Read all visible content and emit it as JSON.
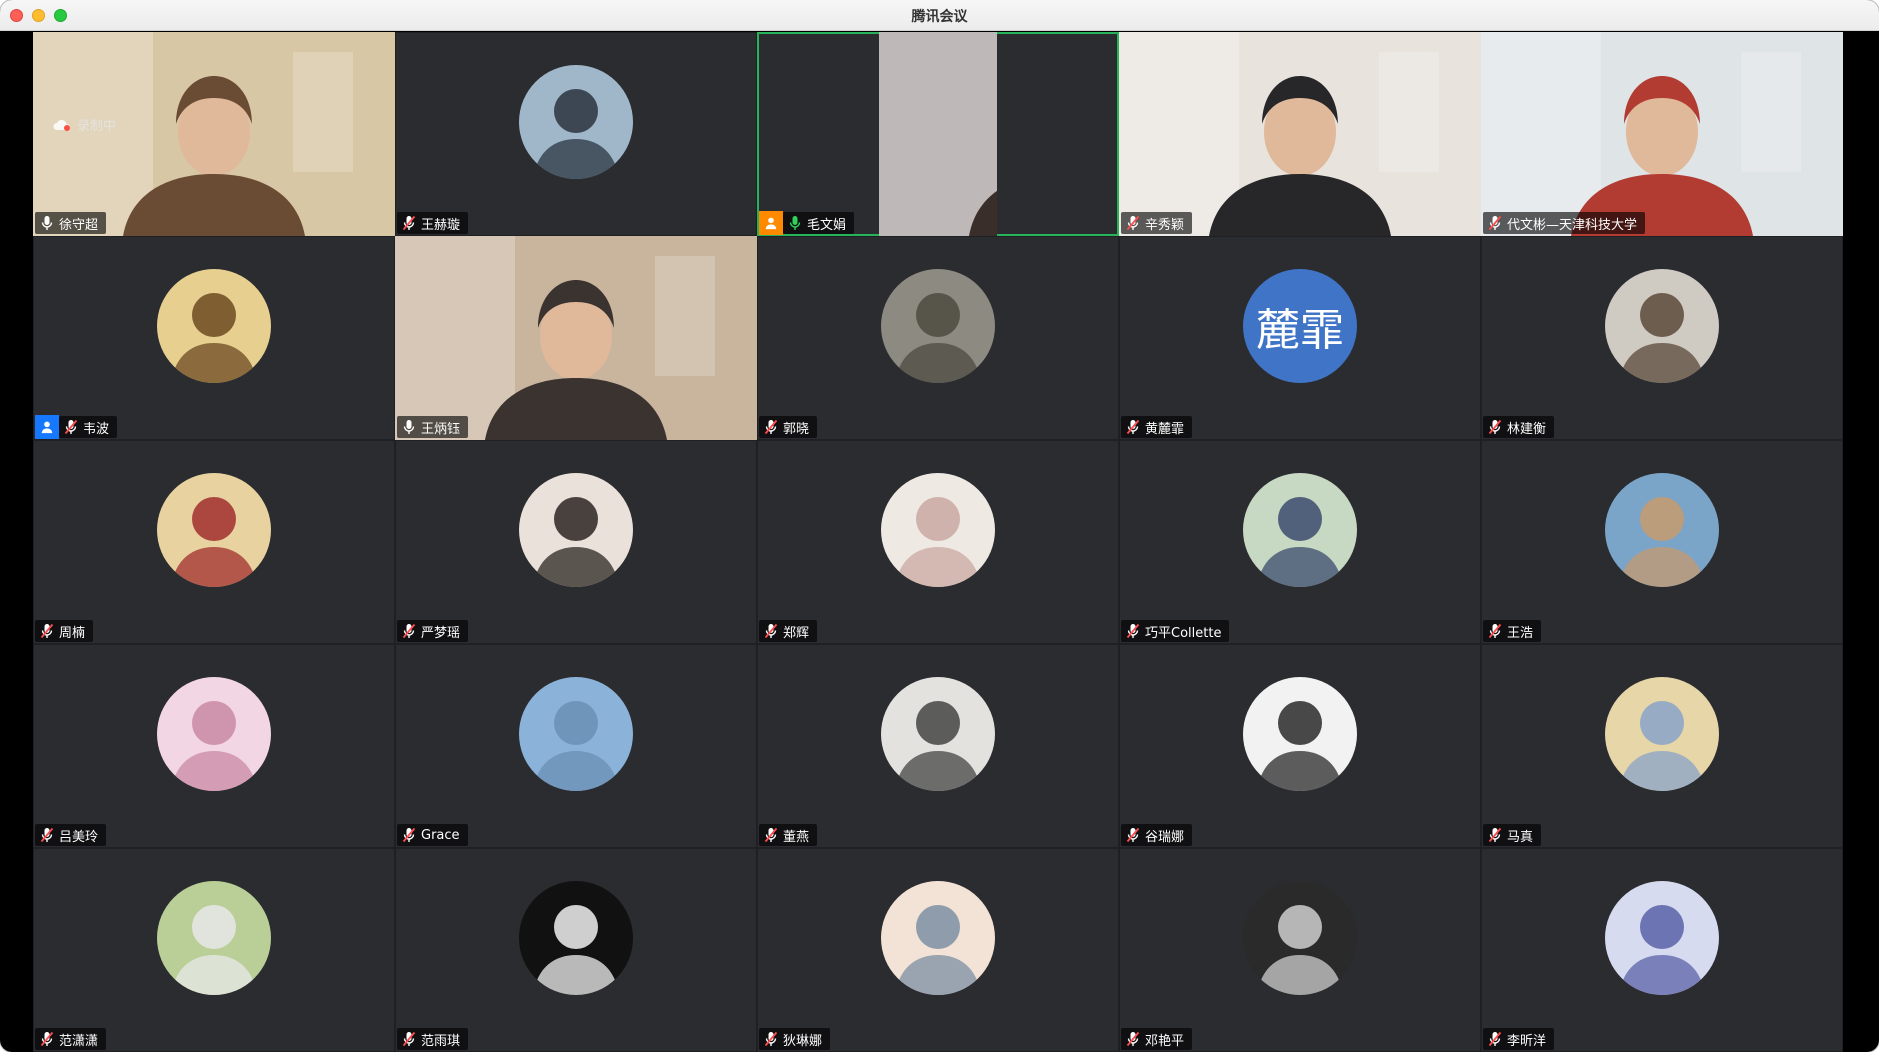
{
  "window": {
    "title": "腾讯会议"
  },
  "recording": {
    "label": "录制中"
  },
  "colors": {
    "active_border": "#26b35a",
    "tile_bg": "#2b2c30",
    "muted_icon": "#ff4d4f",
    "host_blue": "#1677ff",
    "cohost_orange": "#ff8a00"
  },
  "participants": [
    {
      "name": "徐守超",
      "mic": "on",
      "avatar_type": "video",
      "avatar_icon": "man-with-glasses-room-video"
    },
    {
      "name": "王赫璇",
      "mic": "muted",
      "avatar_type": "photo",
      "avatar_icon": "young-person-portrait"
    },
    {
      "name": "毛文娟",
      "mic": "speaking",
      "avatar_type": "video",
      "avatar_icon": "woman-with-glasses-video",
      "badge": "cohost",
      "active": true
    },
    {
      "name": "辛秀颖",
      "mic": "muted",
      "avatar_type": "video",
      "avatar_icon": "woman-room-video"
    },
    {
      "name": "代文彬—天津科技大学",
      "mic": "muted",
      "avatar_type": "video",
      "avatar_icon": "man-living-room-video"
    },
    {
      "name": "韦波",
      "mic": "muted",
      "avatar_type": "photo",
      "avatar_icon": "child-reading-photo",
      "badge": "host"
    },
    {
      "name": "王炳钰",
      "mic": "on",
      "avatar_type": "video",
      "avatar_icon": "woman-with-glasses-room-video"
    },
    {
      "name": "郭晓",
      "mic": "muted",
      "avatar_type": "photo",
      "avatar_icon": "people-sitting-photo"
    },
    {
      "name": "黄麓霏",
      "mic": "muted",
      "avatar_type": "text",
      "avatar_text": "麓霏"
    },
    {
      "name": "林建衡",
      "mic": "muted",
      "avatar_type": "photo",
      "avatar_icon": "man-with-teddy-bear-photo"
    },
    {
      "name": "周楠",
      "mic": "muted",
      "avatar_type": "photo",
      "avatar_icon": "paper-crane-photo"
    },
    {
      "name": "严梦瑶",
      "mic": "muted",
      "avatar_type": "photo",
      "avatar_icon": "woman-portrait-photo"
    },
    {
      "name": "郑辉",
      "mic": "muted",
      "avatar_type": "photo",
      "avatar_icon": "plush-sheep-photo"
    },
    {
      "name": "巧平Collette",
      "mic": "muted",
      "avatar_type": "photo",
      "avatar_icon": "woman-with-flowers-photo"
    },
    {
      "name": "王浩",
      "mic": "muted",
      "avatar_type": "photo",
      "avatar_icon": "beach-photo"
    },
    {
      "name": "吕美玲",
      "mic": "muted",
      "avatar_type": "photo",
      "avatar_icon": "girl-pink-hood-photo"
    },
    {
      "name": "Grace",
      "mic": "muted",
      "avatar_type": "photo",
      "avatar_icon": "sky-sea-photo"
    },
    {
      "name": "董燕",
      "mic": "muted",
      "avatar_type": "photo",
      "avatar_icon": "anime-boy-photo"
    },
    {
      "name": "谷瑞娜",
      "mic": "muted",
      "avatar_type": "photo",
      "avatar_icon": "anime-girl-sketch-photo"
    },
    {
      "name": "马真",
      "mic": "muted",
      "avatar_type": "photo",
      "avatar_icon": "child-bear-hat-photo"
    },
    {
      "name": "范潇潇",
      "mic": "muted",
      "avatar_type": "photo",
      "avatar_icon": "person-in-grass-photo"
    },
    {
      "name": "范雨琪",
      "mic": "muted",
      "avatar_type": "photo",
      "avatar_icon": "young-man-peace-sign-photo"
    },
    {
      "name": "狄琳娜",
      "mic": "muted",
      "avatar_type": "photo",
      "avatar_icon": "anime-boy-scarf-photo"
    },
    {
      "name": "邓艳平",
      "mic": "muted",
      "avatar_type": "photo",
      "avatar_icon": "black-white-portrait-photo"
    },
    {
      "name": "李昕洋",
      "mic": "muted",
      "avatar_type": "photo",
      "avatar_icon": "closed-eye-art-photo"
    }
  ]
}
